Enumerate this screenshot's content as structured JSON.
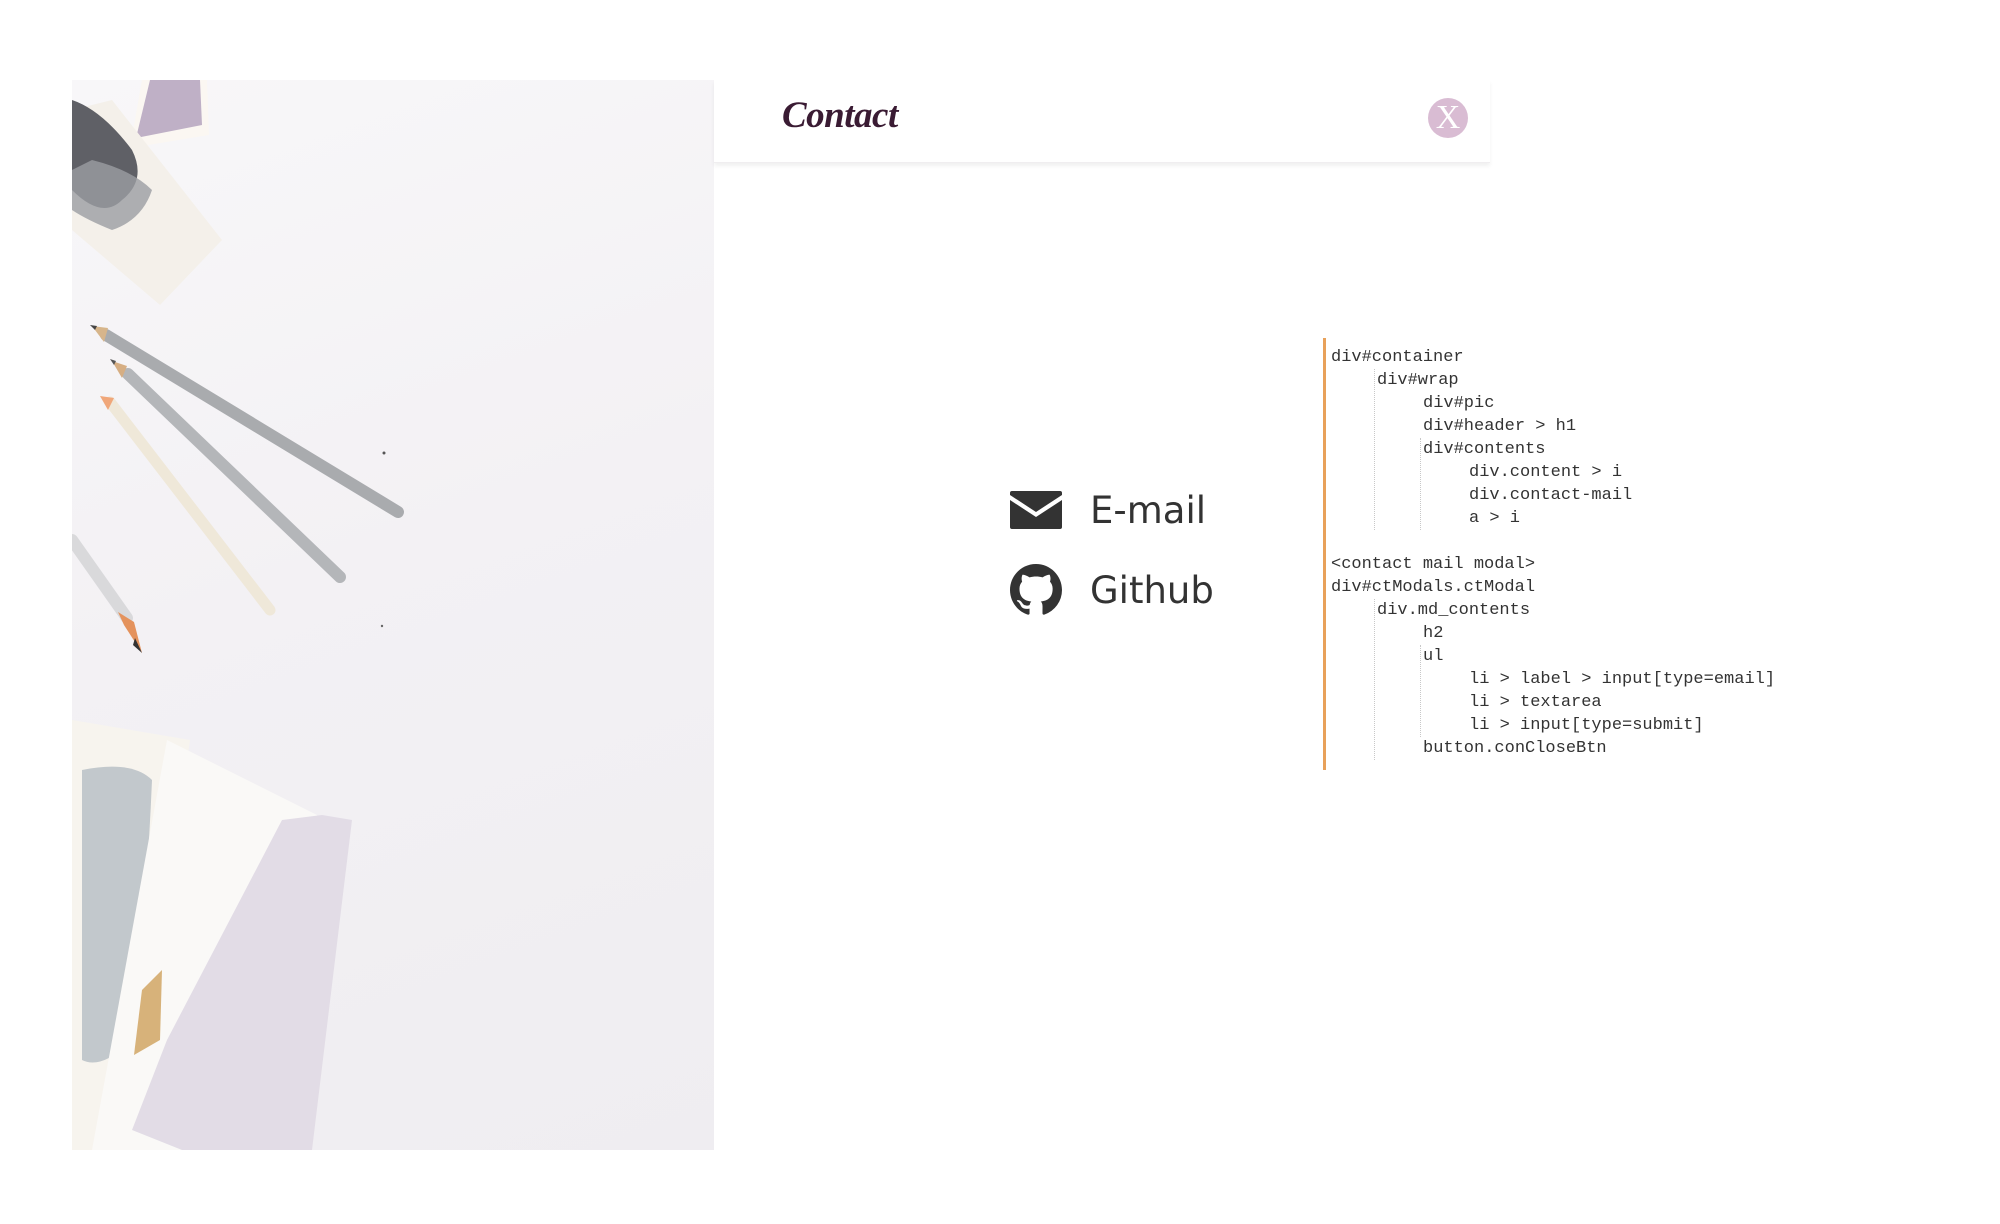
{
  "header": {
    "title": "Contact",
    "close_label": "X"
  },
  "contacts": [
    {
      "label": "E-mail",
      "icon": "envelope-icon"
    },
    {
      "label": "Github",
      "icon": "github-icon"
    }
  ],
  "code_outline": [
    {
      "text": "div#container",
      "indent": 0
    },
    {
      "text": "div#wrap",
      "indent": 1
    },
    {
      "text": "div#pic",
      "indent": 2
    },
    {
      "text": "div#header > h1",
      "indent": 2
    },
    {
      "text": "div#contents",
      "indent": 2
    },
    {
      "text": "div.content > i",
      "indent": 3
    },
    {
      "text": "div.contact-mail",
      "indent": 3
    },
    {
      "text": "a > i",
      "indent": 3
    },
    {
      "text": "",
      "indent": 0
    },
    {
      "text": "<contact mail modal>",
      "indent": 0
    },
    {
      "text": "div#ctModals.ctModal",
      "indent": 0
    },
    {
      "text": "div.md_contents",
      "indent": 1
    },
    {
      "text": "h2",
      "indent": 2
    },
    {
      "text": "ul",
      "indent": 2
    },
    {
      "text": "li > label > input[type=email]",
      "indent": 3
    },
    {
      "text": "li > textarea",
      "indent": 3
    },
    {
      "text": "li > input[type=submit]",
      "indent": 3
    },
    {
      "text": "button.conCloseBtn",
      "indent": 2
    }
  ],
  "colors": {
    "title": "#3a1b33",
    "close_button": "#d9bcd3",
    "code_border": "#e8a15a",
    "icon": "#333333"
  }
}
